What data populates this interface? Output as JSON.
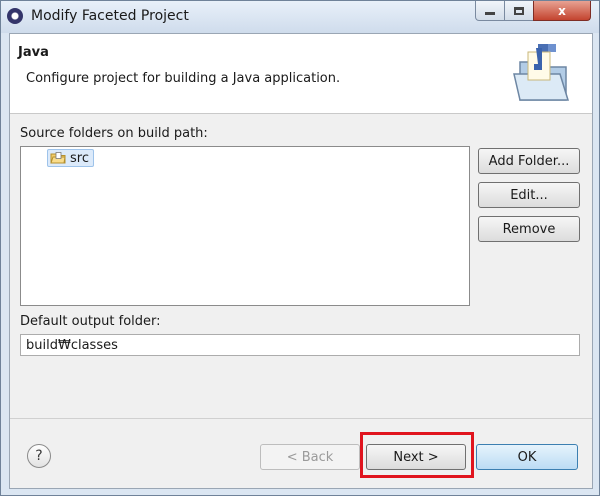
{
  "window": {
    "title": "Modify Faceted Project",
    "close_glyph": "x"
  },
  "header": {
    "title": "Java",
    "description": "Configure project for building a Java application.",
    "icon": "java-folder-icon"
  },
  "source": {
    "label": "Source folders on build path:",
    "items": [
      {
        "label": "src",
        "icon": "source-folder-icon",
        "selected": true
      }
    ]
  },
  "buttons": {
    "add_folder": "Add Folder...",
    "edit": "Edit...",
    "remove": "Remove",
    "back": "< Back",
    "next": "Next >",
    "ok": "OK",
    "help": "?"
  },
  "output": {
    "label": "Default output folder:",
    "value": "build₩classes"
  },
  "colors": {
    "highlight": "#e0141e",
    "ok_button": "#bcdcf4",
    "close_button": "#c3442f"
  }
}
